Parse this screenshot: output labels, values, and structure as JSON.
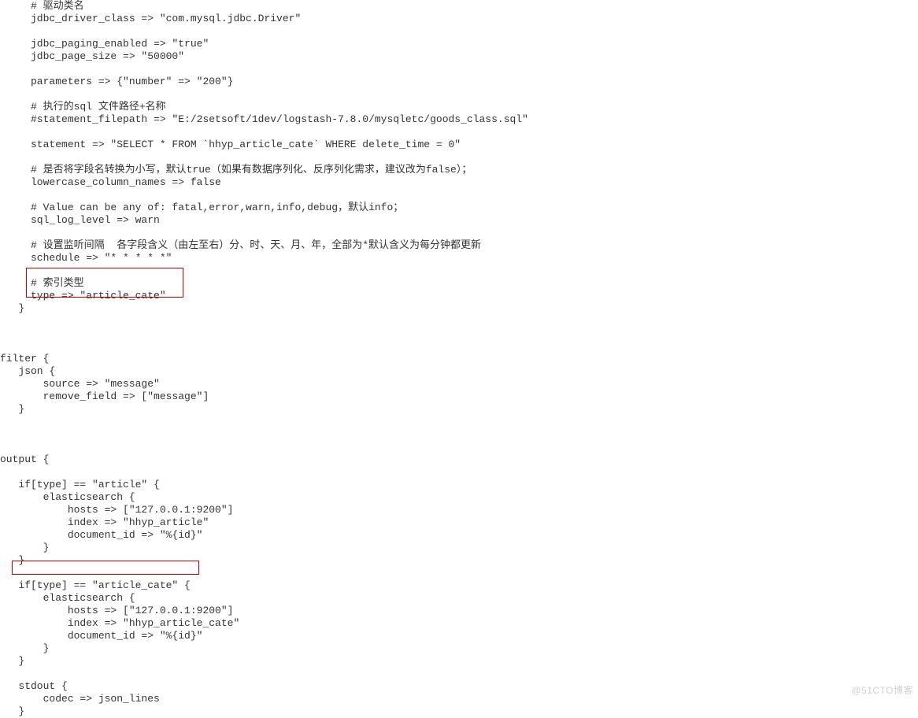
{
  "code": {
    "l01": "     # 驱动类名",
    "l02": "     jdbc_driver_class => \"com.mysql.jdbc.Driver\"",
    "l03": "",
    "l04": "     jdbc_paging_enabled => \"true\"",
    "l05": "     jdbc_page_size => \"50000\"",
    "l06": "",
    "l07": "     parameters => {\"number\" => \"200\"}",
    "l08": "",
    "l09": "     # 执行的sql 文件路径+名称",
    "l10": "     #statement_filepath => \"E:/2setsoft/1dev/logstash-7.8.0/mysqletc/goods_class.sql\"",
    "l11": "",
    "l12": "     statement => \"SELECT * FROM `hhyp_article_cate` WHERE delete_time = 0\"",
    "l13": "",
    "l14": "     # 是否将字段名转换为小写，默认true（如果有数据序列化、反序列化需求，建议改为false）；",
    "l15": "     lowercase_column_names => false",
    "l16": "",
    "l17": "     # Value can be any of: fatal,error,warn,info,debug，默认info；",
    "l18": "     sql_log_level => warn",
    "l19": "",
    "l20": "     # 设置监听间隔  各字段含义（由左至右）分、时、天、月、年，全部为*默认含义为每分钟都更新",
    "l21": "     schedule => \"* * * * *\"",
    "l22": "",
    "l23": "     # 索引类型",
    "l24": "     type => \"article_cate\"",
    "l25": "   }",
    "l26": "",
    "l27": "",
    "l28": "",
    "l29": "filter {",
    "l30": "   json {",
    "l31": "       source => \"message\"",
    "l32": "       remove_field => [\"message\"]",
    "l33": "   }",
    "l34": "",
    "l35": "",
    "l36": "",
    "l37": "output {",
    "l38": "",
    "l39": "   if[type] == \"article\" {",
    "l40": "       elasticsearch {",
    "l41": "           hosts => [\"127.0.0.1:9200\"]",
    "l42": "           index => \"hhyp_article\"",
    "l43": "           document_id => \"%{id}\"",
    "l44": "       }",
    "l45": "   }",
    "l46": "",
    "l47": "   if[type] == \"article_cate\" {",
    "l48": "       elasticsearch {",
    "l49": "           hosts => [\"127.0.0.1:9200\"]",
    "l50": "           index => \"hhyp_article_cate\"",
    "l51": "           document_id => \"%{id}\"",
    "l52": "       }",
    "l53": "   }",
    "l54": "",
    "l55": "   stdout {",
    "l56": "       codec => json_lines",
    "l57": "   }"
  },
  "watermark": "@51CTO博客"
}
